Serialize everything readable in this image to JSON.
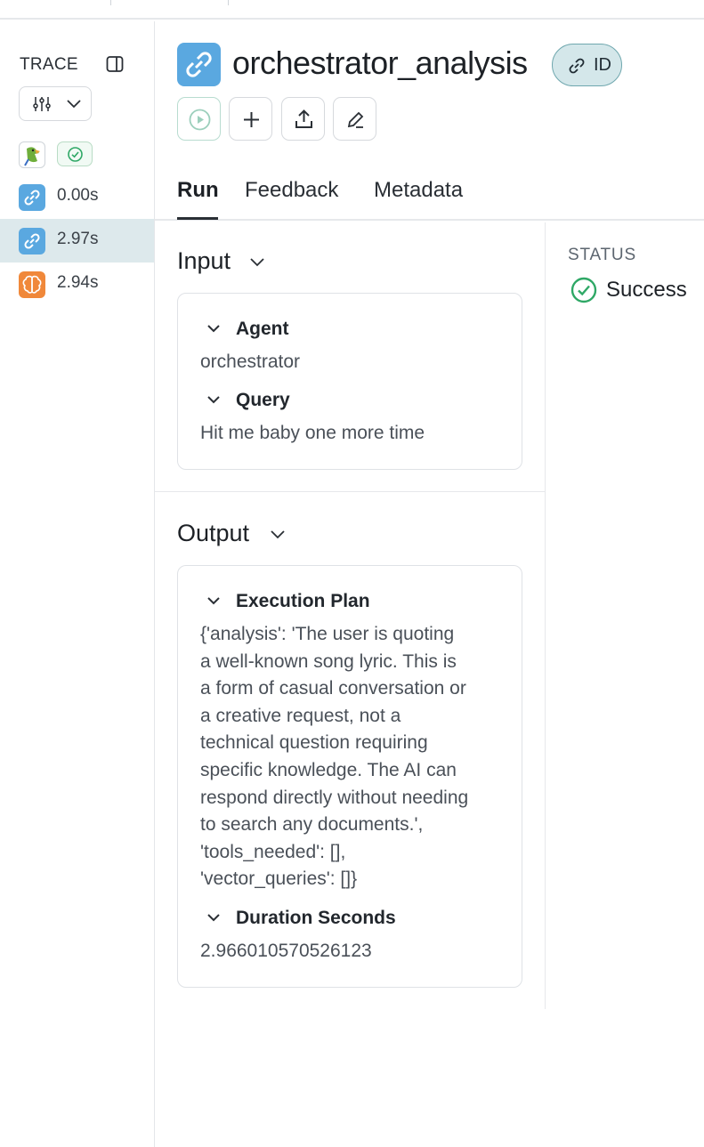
{
  "sidebar": {
    "title": "TRACE",
    "nodes": [
      {
        "icon": "parrot-icon",
        "status": "check-circle-icon"
      },
      {
        "icon": "link-icon",
        "label": "0.00s",
        "selected": false
      },
      {
        "icon": "link-icon",
        "label": "2.97s",
        "selected": true
      },
      {
        "icon": "brain-icon",
        "label": "2.94s",
        "selected": false
      }
    ]
  },
  "header": {
    "title": "orchestrator_analysis",
    "id_label": "ID",
    "toolbar": [
      "play-icon",
      "plus-icon",
      "share-icon",
      "edit-icon"
    ]
  },
  "tabs": [
    {
      "label": "Run",
      "active": true
    },
    {
      "label": "Feedback",
      "active": false
    },
    {
      "label": "Metadata",
      "active": false
    }
  ],
  "input": {
    "title": "Input",
    "fields": [
      {
        "label": "Agent",
        "value": "orchestrator"
      },
      {
        "label": "Query",
        "value": "Hit me baby one more time"
      }
    ]
  },
  "output": {
    "title": "Output",
    "fields": [
      {
        "label": "Execution Plan",
        "lines": [
          "{'analysis': 'The user is quoting",
          "a well-known song lyric. This is",
          "a form of casual conversation or",
          "a creative request, not a",
          "technical question requiring",
          "specific knowledge. The AI can",
          "respond directly without needing",
          "to search any documents.',",
          "'tools_needed': [],",
          "'vector_queries': []}"
        ]
      },
      {
        "label": "Duration Seconds",
        "value": "2.966010570526123"
      }
    ]
  },
  "status": {
    "label": "STATUS",
    "value": "Success",
    "color": "#2fa866"
  },
  "colors": {
    "link_icon_bg": "#5aa8e0",
    "brain_icon_bg": "#f0883a",
    "selected_row_bg": "#dde9ec",
    "id_pill_bg": "#d4e7ea"
  }
}
